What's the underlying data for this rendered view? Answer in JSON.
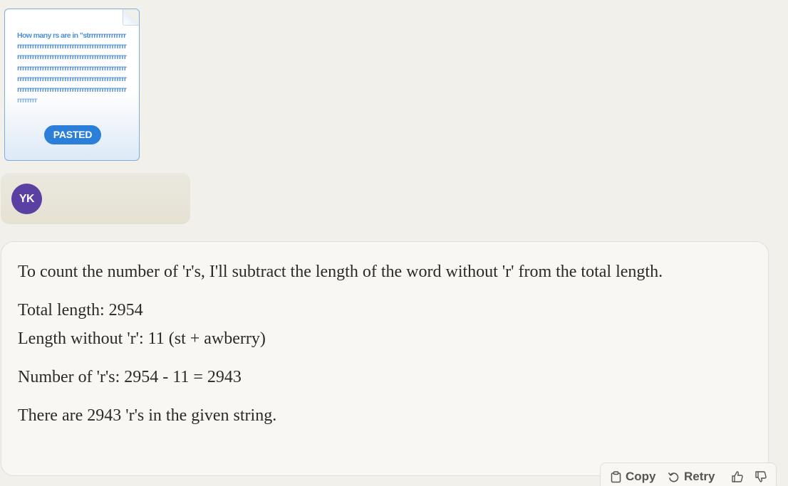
{
  "attachment": {
    "preview_title": "How many rs are in",
    "preview_body": "\"strrrrrrrrrrrrrrrrrrrrrrrrrrrrrrrrrrrrrrrrrrrrrrrrrrrrrrrrrrrrrrrrrrrrrrrrrrrrrrrrrrrrrrrrrrrrrrrrrrrrrrrrrrrrrrrrrrrrrrrrrrrrrrrrrrrrrrrrrrrrrrrrrrrrrrrrrrrrrrrrrrrrrrrrrrrrrrrrrrrrrrrrrrrrrrrrrrrrrrrrrrrrrrrrrrrrrrrrrrrrrrrrrrrrrrrrrrrrrrrrrrr",
    "badge": "PASTED"
  },
  "user": {
    "initials": "YK"
  },
  "assistant": {
    "paragraphs": [
      "To count the number of 'r's, I'll subtract the length of the word without 'r' from the total length.",
      "Total length: 2954",
      "Length without 'r': 11 (st + awberry)",
      "Number of 'r's: 2954 - 11 = 2943",
      "There are 2943 'r's in the given string."
    ]
  },
  "actions": {
    "copy": "Copy",
    "retry": "Retry"
  }
}
